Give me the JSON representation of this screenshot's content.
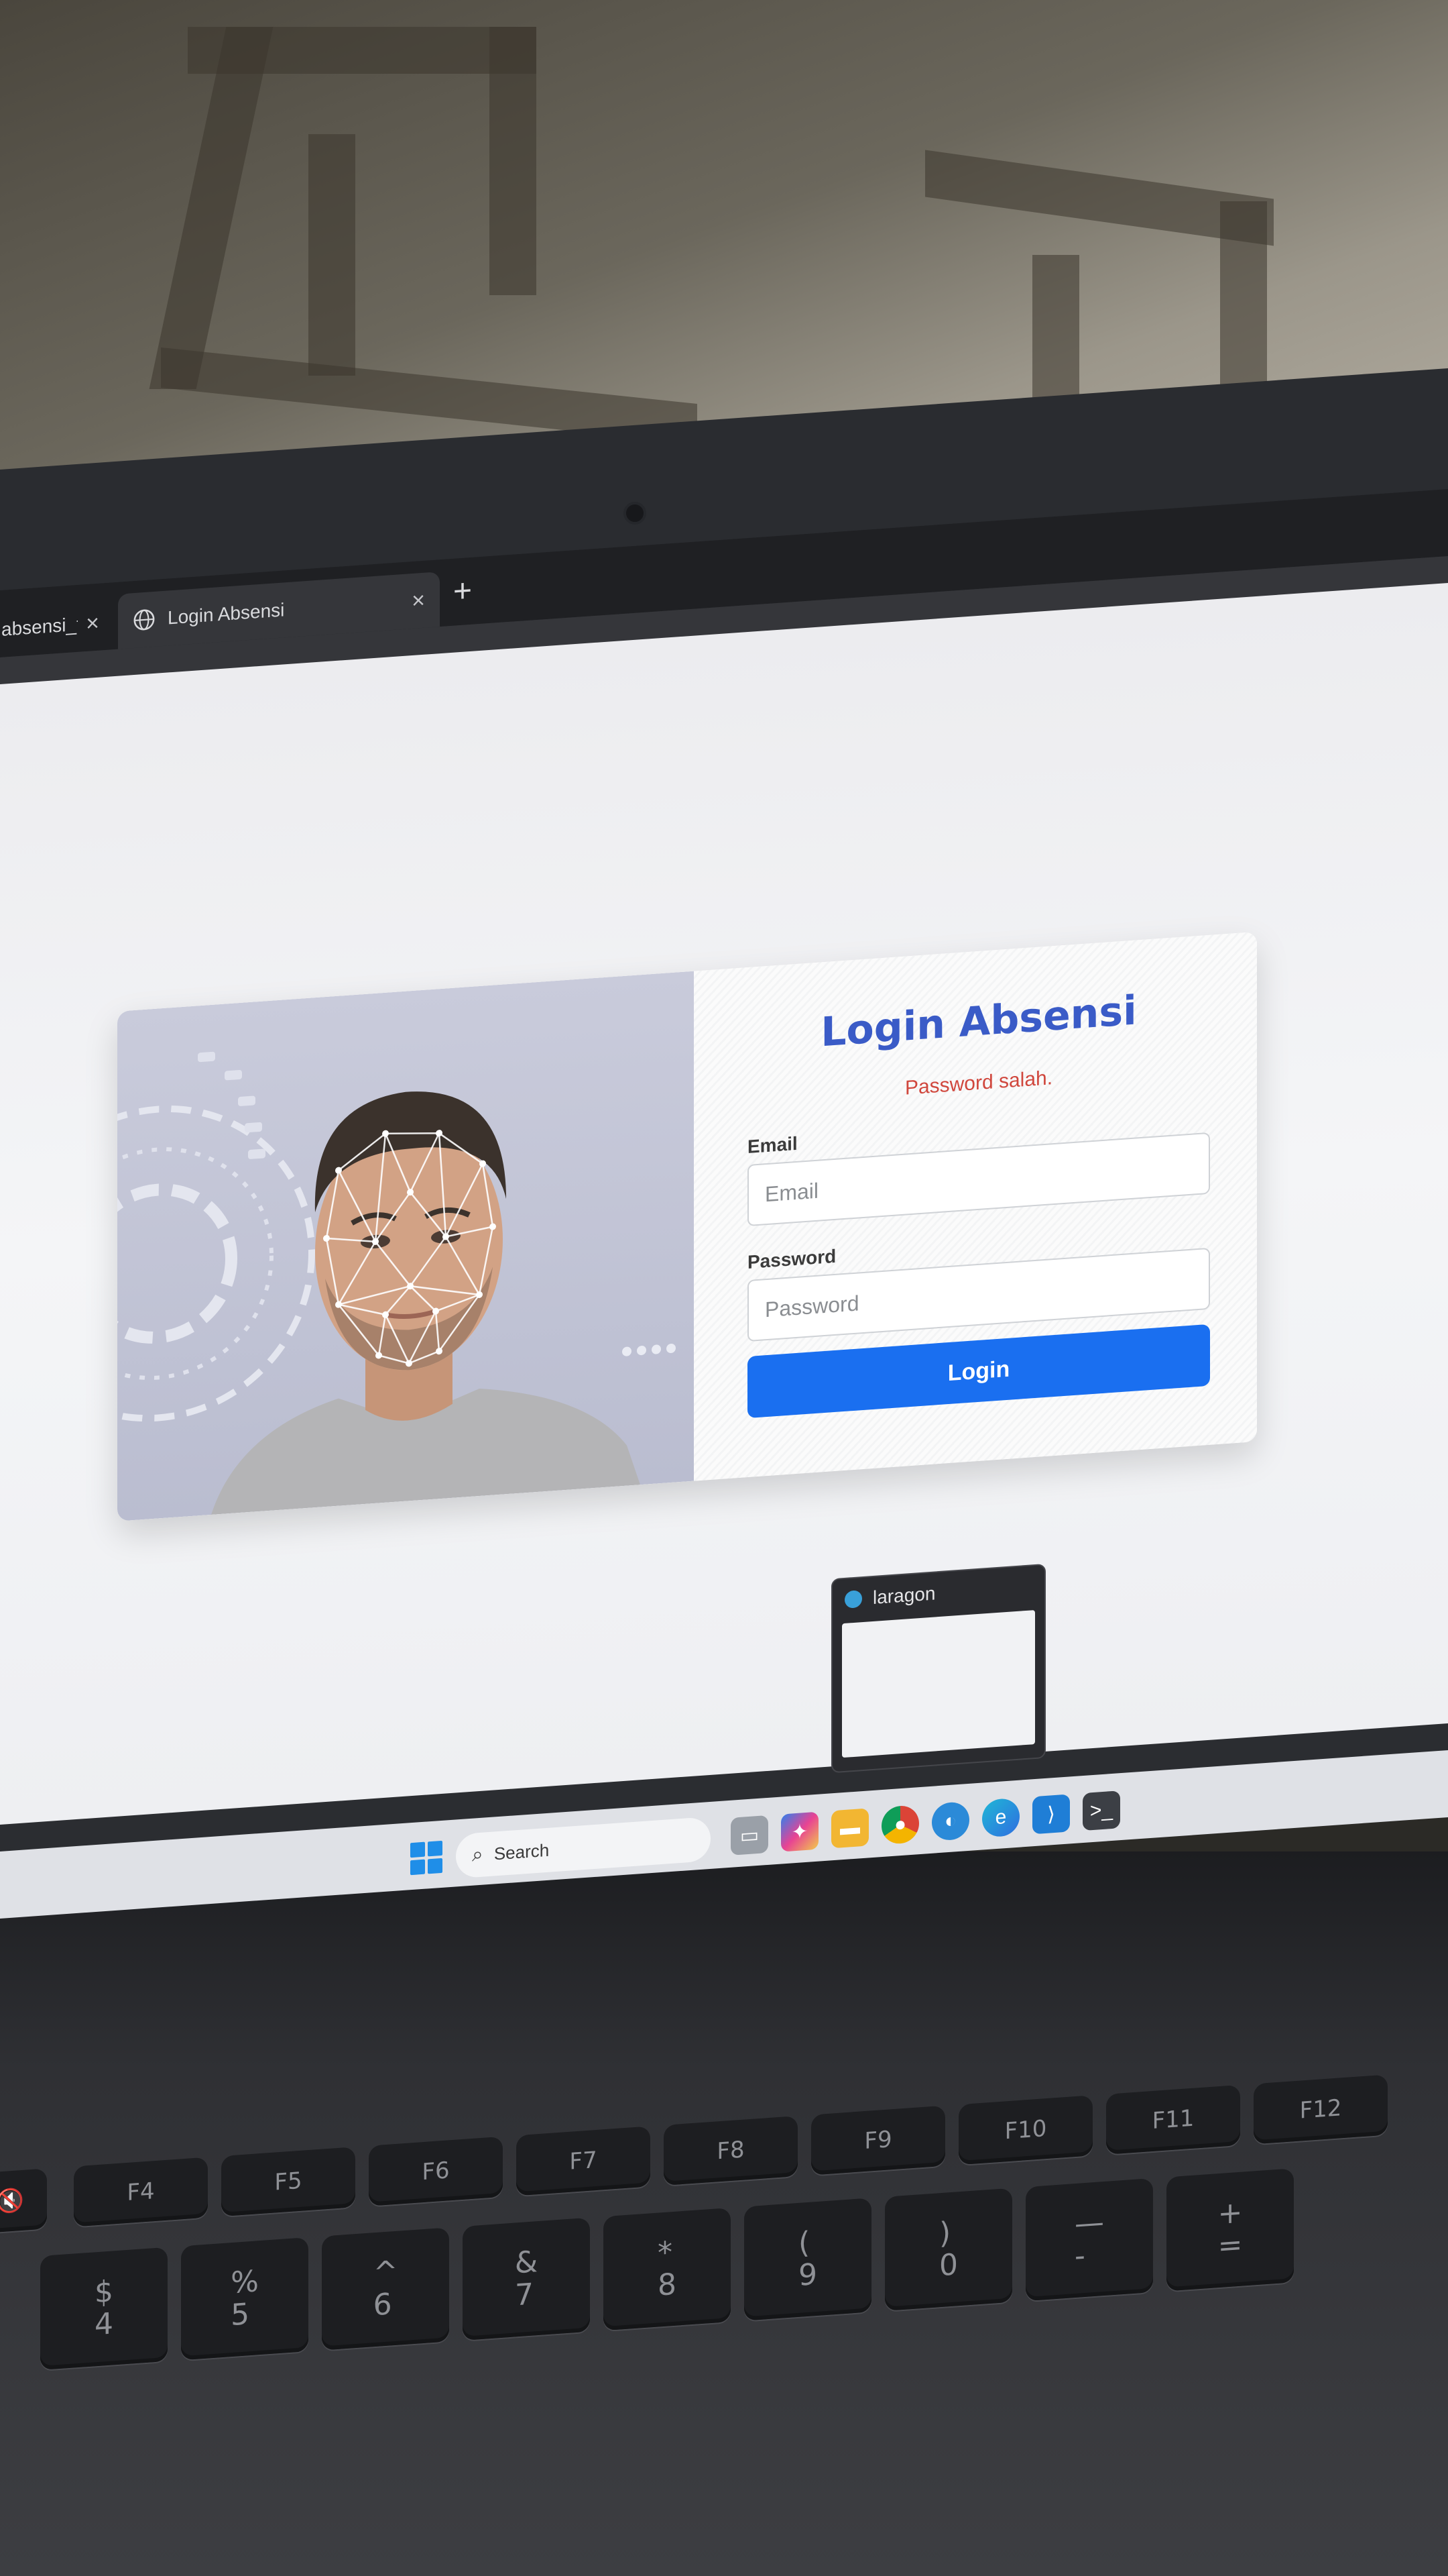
{
  "browser": {
    "tabs": [
      {
        "title": "absensi_fa",
        "active": false,
        "close_icon": "×"
      },
      {
        "title": "Login Absensi",
        "active": true,
        "close_icon": "×"
      }
    ],
    "new_tab_icon": "+"
  },
  "login": {
    "title": "Login Absensi",
    "error": "Password salah.",
    "email_label": "Email",
    "email_placeholder": "Email",
    "password_label": "Password",
    "password_placeholder": "Password",
    "button_label": "Login"
  },
  "taskbar": {
    "search_label": "Search",
    "preview_title": "laragon",
    "apps": [
      "file-explorer-icon",
      "copilot-icon",
      "folder-icon",
      "chrome-icon",
      "laragon-icon",
      "edge-icon",
      "vscode-icon",
      "terminal-icon"
    ]
  },
  "keyboard": {
    "function_keys": [
      "F4",
      "F5",
      "F6",
      "F7",
      "F8",
      "F9",
      "F10",
      "F11",
      "F12"
    ],
    "number_keys": [
      "$\n4",
      "%\n5",
      "^\n6",
      "&\n7",
      "*\n8",
      "(\n9",
      ")\n0",
      "—\n-",
      "+\n="
    ]
  },
  "colors": {
    "accent": "#3a5bc7",
    "button": "#1a6ff0",
    "error": "#d0473d"
  }
}
